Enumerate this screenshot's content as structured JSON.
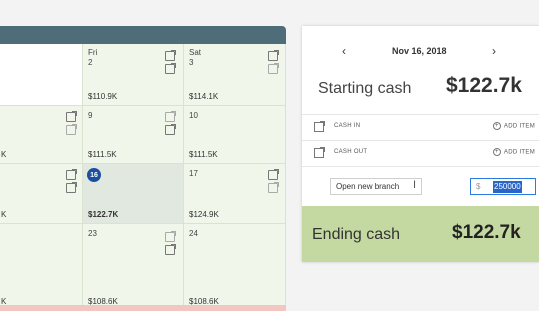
{
  "calendar": {
    "cells": [
      {
        "id": "r1c1",
        "day": "",
        "num": "",
        "amount": ""
      },
      {
        "id": "r1c2",
        "day": "Fri",
        "num": "2",
        "amount": "$110.9K"
      },
      {
        "id": "r1c3",
        "day": "Sat",
        "num": "3",
        "amount": "$114.1K"
      },
      {
        "id": "r2c1",
        "day": "",
        "num": "",
        "amount": "K"
      },
      {
        "id": "r2c2",
        "day": "",
        "num": "9",
        "amount": "$111.5K"
      },
      {
        "id": "r2c3",
        "day": "",
        "num": "10",
        "amount": "$111.5K"
      },
      {
        "id": "r3c1",
        "day": "",
        "num": "",
        "amount": "K"
      },
      {
        "id": "r3c2",
        "day": "",
        "num": "16",
        "amount": "$122.7K"
      },
      {
        "id": "r3c3",
        "day": "",
        "num": "17",
        "amount": "$124.9K"
      },
      {
        "id": "r4c1",
        "day": "",
        "num": "",
        "amount": "K"
      },
      {
        "id": "r4c2",
        "day": "",
        "num": "23",
        "amount": "$108.6K"
      },
      {
        "id": "r4c3",
        "day": "",
        "num": "24",
        "amount": "$108.6K"
      }
    ]
  },
  "panel": {
    "prev": "‹",
    "date": "Nov 16, 2018",
    "next": "›",
    "starting_label": "Starting cash",
    "starting_value": "$122.7k",
    "cash_in_label": "CASH IN",
    "cash_out_label": "CASH OUT",
    "add_item_label": "ADD ITEM",
    "entry_name": "Open new branch",
    "currency_symbol": "$",
    "entry_amount": "250000",
    "ending_label": "Ending cash",
    "ending_value": "$122.7k"
  },
  "colors": {
    "header": "#4f6d78",
    "cell_bg": "#f0f6ea",
    "selected_badge": "#1d4f9c",
    "ending_bg": "#c4d9a2",
    "selection": "#2a65c8"
  }
}
